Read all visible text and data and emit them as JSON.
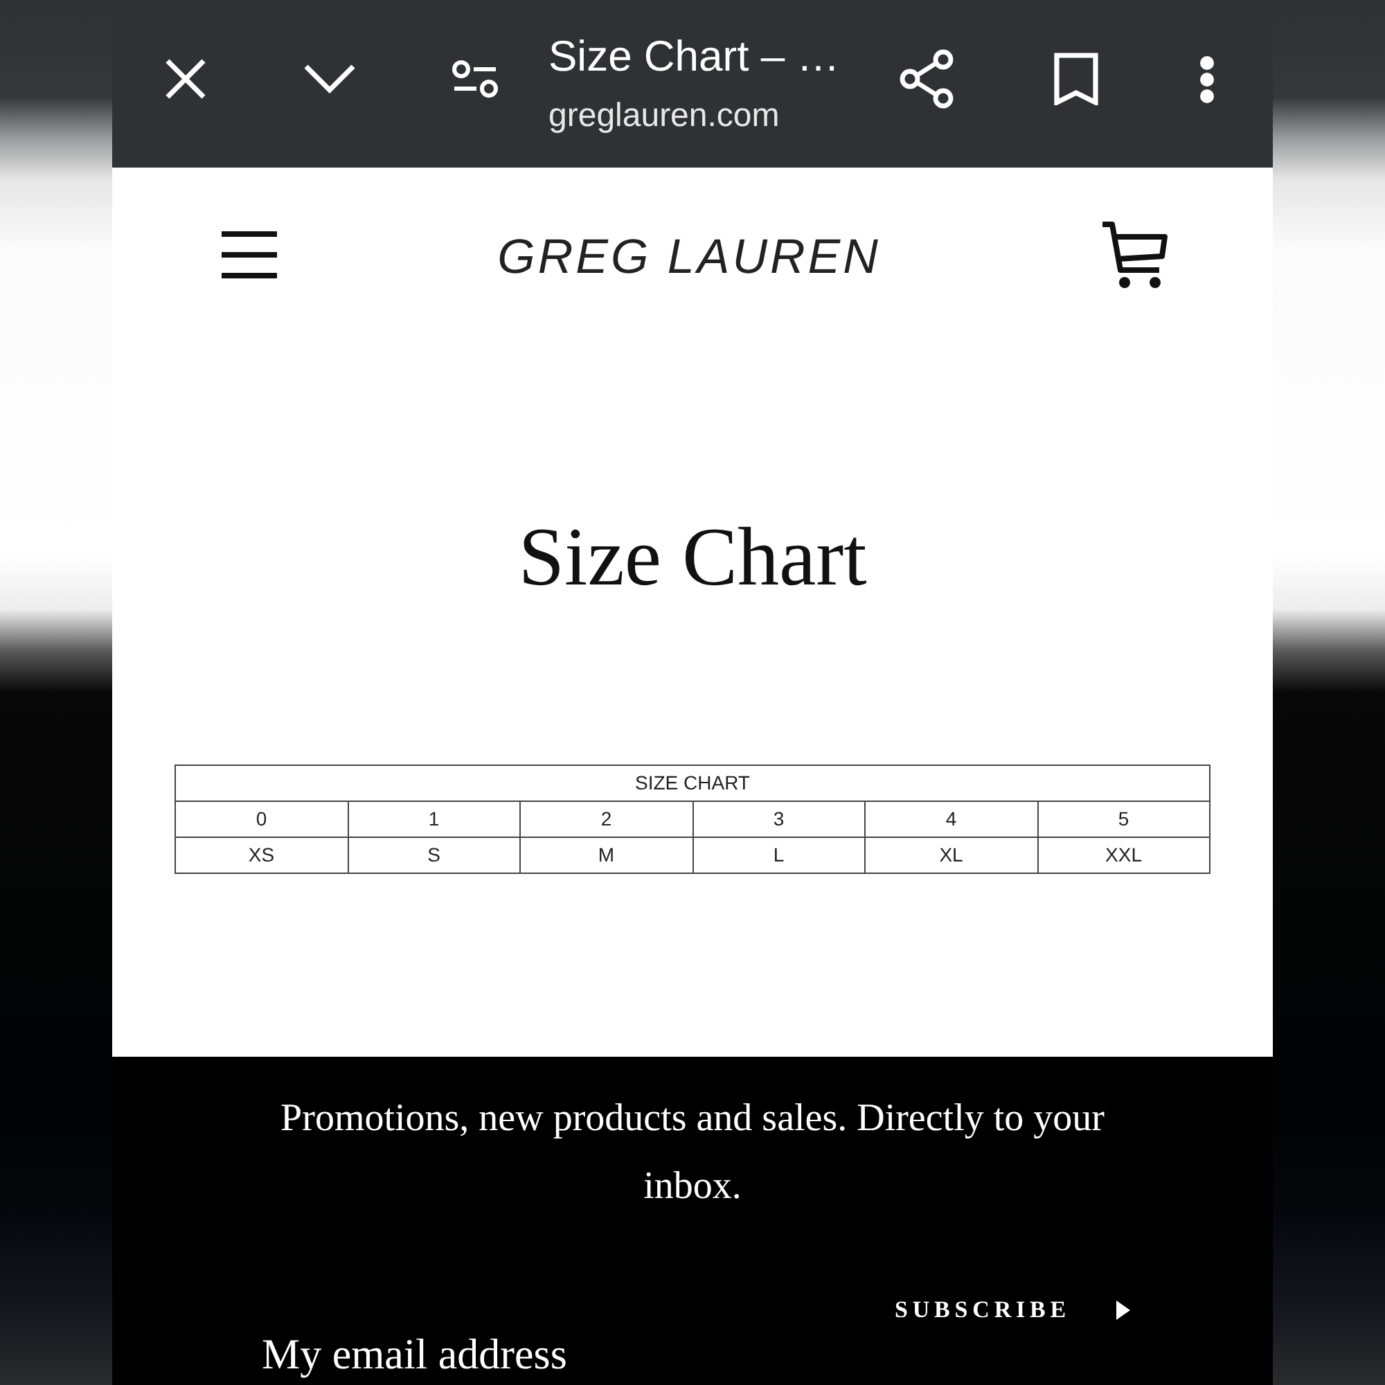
{
  "browser_bar": {
    "title": "Size Chart – …",
    "url": "greglauren.com"
  },
  "site_header": {
    "logo": "GREG LAUREN"
  },
  "page": {
    "heading": "Size Chart"
  },
  "size_table": {
    "title": "SIZE CHART",
    "rows": [
      [
        "0",
        "1",
        "2",
        "3",
        "4",
        "5"
      ],
      [
        "XS",
        "S",
        "M",
        "L",
        "XL",
        "XXL"
      ]
    ]
  },
  "newsletter": {
    "text": "Promotions, new products and sales. Directly to your inbox.",
    "button": "SUBSCRIBE",
    "email_field": {
      "placeholder": "My email address"
    }
  }
}
